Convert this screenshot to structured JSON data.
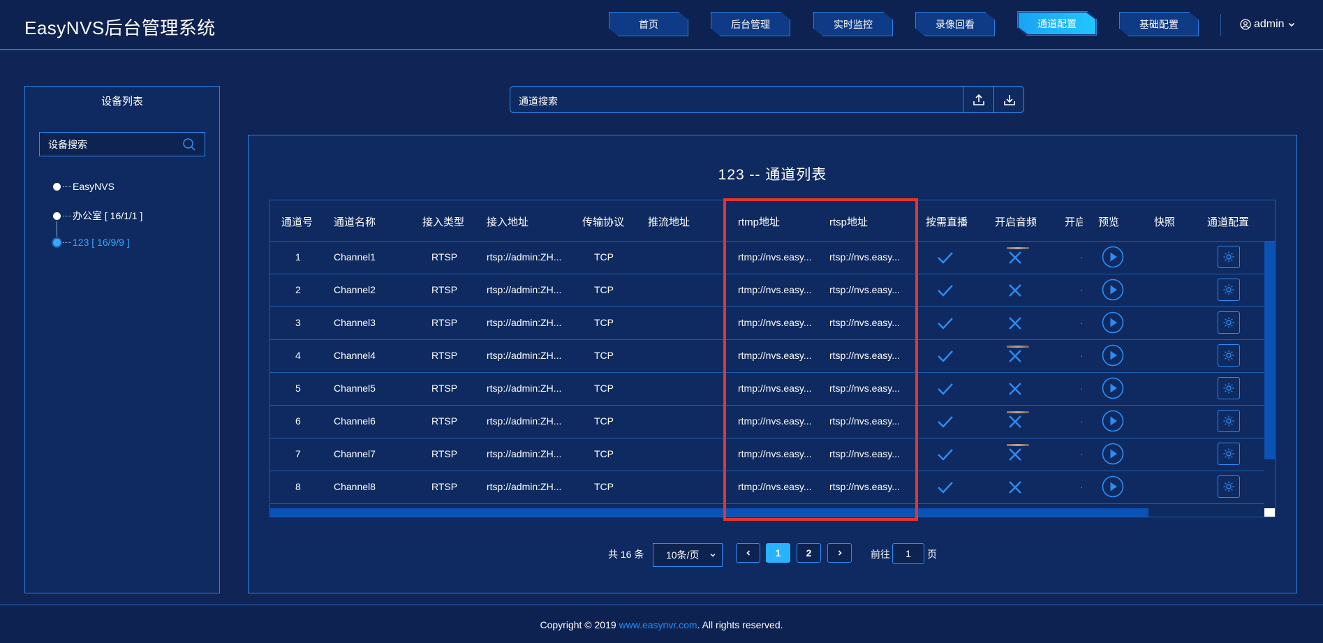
{
  "app": {
    "title": "EasyNVS后台管理系统"
  },
  "nav": {
    "tabs": [
      {
        "label": "首页"
      },
      {
        "label": "后台管理"
      },
      {
        "label": "实时监控"
      },
      {
        "label": "录像回看"
      },
      {
        "label": "通道配置",
        "active": true
      },
      {
        "label": "基础配置"
      }
    ],
    "user": "admin"
  },
  "sidebar": {
    "title": "设备列表",
    "search_placeholder": "设备搜索",
    "tree": [
      {
        "label": "EasyNVS"
      },
      {
        "label": "办公室 [ 16/1/1 ]"
      },
      {
        "label": "123 [ 16/9/9 ]",
        "selected": true
      }
    ]
  },
  "channel_search": {
    "placeholder": "通道搜索"
  },
  "panel": {
    "title": "123 -- 通道列表"
  },
  "table": {
    "columns": [
      "通道号",
      "通道名称",
      "接入类型",
      "接入地址",
      "传输协议",
      "推流地址",
      "rtmp地址",
      "rtsp地址",
      "按需直播",
      "开启音频",
      "开启",
      "预览",
      "快照",
      "通道配置"
    ],
    "rows": [
      {
        "no": "1",
        "name": "Channel1",
        "type": "RTSP",
        "addr": "rtsp://admin:ZH...",
        "proto": "TCP",
        "push": "",
        "rtmp": "rtmp://nvs.easy...",
        "rtsp": "rtsp://nvs.easy...",
        "on_demand": true,
        "audio": false,
        "snapshot": true
      },
      {
        "no": "2",
        "name": "Channel2",
        "type": "RTSP",
        "addr": "rtsp://admin:ZH...",
        "proto": "TCP",
        "push": "",
        "rtmp": "rtmp://nvs.easy...",
        "rtsp": "rtsp://nvs.easy...",
        "on_demand": true,
        "audio": false,
        "snapshot": false
      },
      {
        "no": "3",
        "name": "Channel3",
        "type": "RTSP",
        "addr": "rtsp://admin:ZH...",
        "proto": "TCP",
        "push": "",
        "rtmp": "rtmp://nvs.easy...",
        "rtsp": "rtsp://nvs.easy...",
        "on_demand": true,
        "audio": false,
        "snapshot": false
      },
      {
        "no": "4",
        "name": "Channel4",
        "type": "RTSP",
        "addr": "rtsp://admin:ZH...",
        "proto": "TCP",
        "push": "",
        "rtmp": "rtmp://nvs.easy...",
        "rtsp": "rtsp://nvs.easy...",
        "on_demand": true,
        "audio": false,
        "snapshot": true
      },
      {
        "no": "5",
        "name": "Channel5",
        "type": "RTSP",
        "addr": "rtsp://admin:ZH...",
        "proto": "TCP",
        "push": "",
        "rtmp": "rtmp://nvs.easy...",
        "rtsp": "rtsp://nvs.easy...",
        "on_demand": true,
        "audio": false,
        "snapshot": false
      },
      {
        "no": "6",
        "name": "Channel6",
        "type": "RTSP",
        "addr": "rtsp://admin:ZH...",
        "proto": "TCP",
        "push": "",
        "rtmp": "rtmp://nvs.easy...",
        "rtsp": "rtsp://nvs.easy...",
        "on_demand": true,
        "audio": false,
        "snapshot": true
      },
      {
        "no": "7",
        "name": "Channel7",
        "type": "RTSP",
        "addr": "rtsp://admin:ZH...",
        "proto": "TCP",
        "push": "",
        "rtmp": "rtmp://nvs.easy...",
        "rtsp": "rtsp://nvs.easy...",
        "on_demand": true,
        "audio": false,
        "snapshot": true
      },
      {
        "no": "8",
        "name": "Channel8",
        "type": "RTSP",
        "addr": "rtsp://admin:ZH...",
        "proto": "TCP",
        "push": "",
        "rtmp": "rtmp://nvs.easy...",
        "rtsp": "rtsp://nvs.easy...",
        "on_demand": true,
        "audio": false,
        "snapshot": false
      }
    ]
  },
  "pagination": {
    "total": "共 16 条",
    "page_size": "10条/页",
    "pages": [
      "1",
      "2"
    ],
    "current": "1",
    "goto_label": "前往",
    "goto_value": "1",
    "page_suffix": "页"
  },
  "footer": {
    "prefix": "Copyright © 2019 ",
    "link": "www.easynvr.com",
    "suffix": ". All rights reserved."
  },
  "colors": {
    "background": "#102455",
    "accent": "#2e8cf2",
    "active_tab": "#22c6ff",
    "highlight": "#e5342d"
  }
}
